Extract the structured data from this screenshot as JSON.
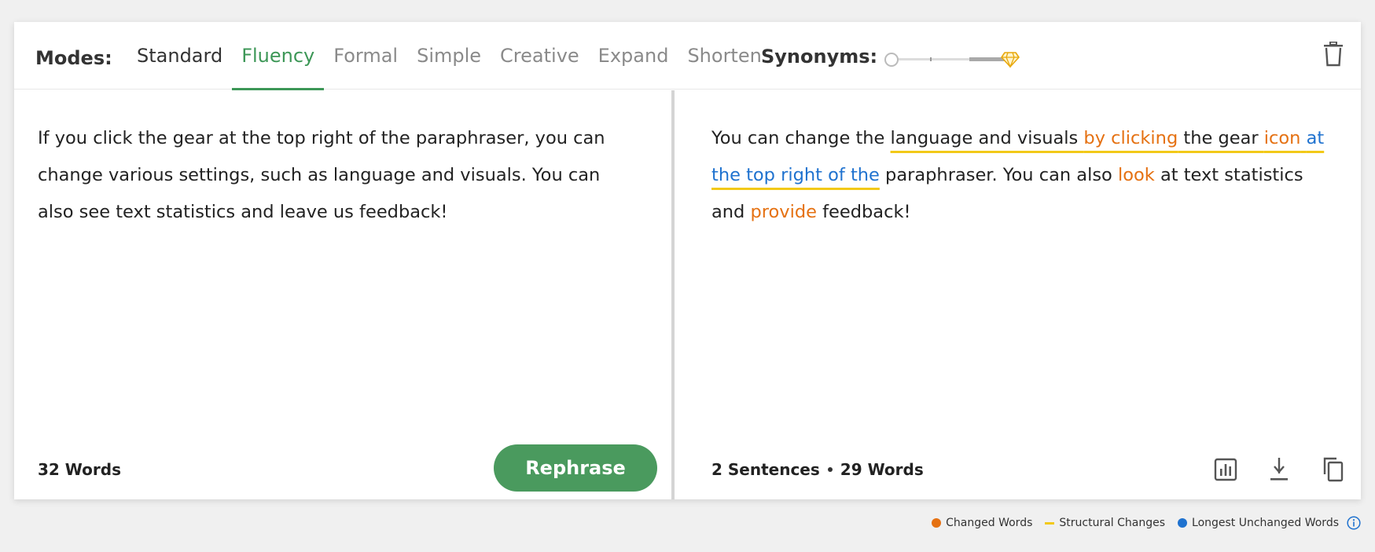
{
  "toolbar": {
    "modes_label": "Modes:",
    "tabs": [
      {
        "label": "Standard"
      },
      {
        "label": "Fluency"
      },
      {
        "label": "Formal"
      },
      {
        "label": "Simple"
      },
      {
        "label": "Creative"
      },
      {
        "label": "Expand"
      },
      {
        "label": "Shorten"
      }
    ],
    "active_tab": "Fluency",
    "synonyms_label": "Synonyms:",
    "synonyms_level": 0
  },
  "input": {
    "text": "If you click the gear at the top right of the paraphraser, you can change various settings, such as language and visuals. You can also see text statistics and leave us feedback!",
    "word_count": "32 Words",
    "rephrase_label": "Rephrase"
  },
  "output": {
    "segments": [
      {
        "t": "You can change the ",
        "type": "plain"
      },
      {
        "t": "language and visuals ",
        "type": "structural"
      },
      {
        "t": "by clicking",
        "type": "changed-structural"
      },
      {
        "t": " the gear ",
        "type": "structural"
      },
      {
        "t": "icon",
        "type": "changed-structural"
      },
      {
        "t": " ",
        "type": "structural"
      },
      {
        "t": "at the top right of the",
        "type": "unchanged-structural"
      },
      {
        "t": " paraphraser. You can also ",
        "type": "plain"
      },
      {
        "t": "look",
        "type": "changed"
      },
      {
        "t": " at text statistics and ",
        "type": "plain"
      },
      {
        "t": "provide",
        "type": "changed"
      },
      {
        "t": " feedback!",
        "type": "plain"
      }
    ],
    "sentences": "2 Sentences",
    "word_count": "29 Words"
  },
  "legend": {
    "changed": "Changed Words",
    "structural": "Structural Changes",
    "unchanged": "Longest Unchanged Words"
  },
  "colors": {
    "accent": "#3d9757",
    "changed": "#e57112",
    "unchanged": "#1f72cf",
    "structural": "#f2c919"
  }
}
